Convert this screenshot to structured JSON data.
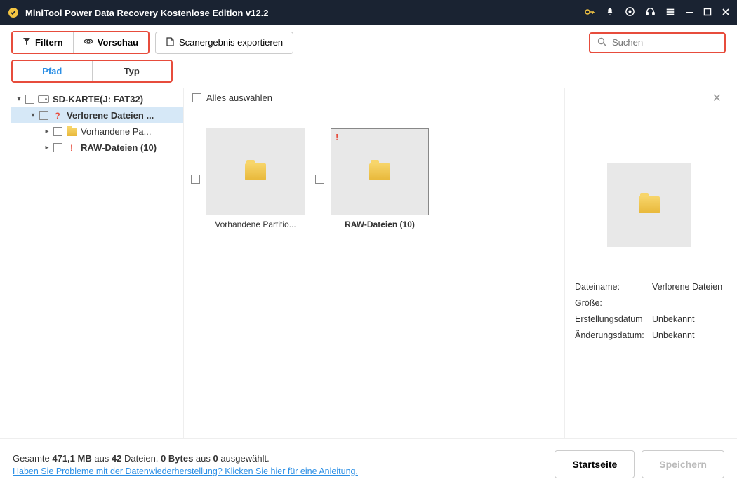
{
  "titlebar": {
    "title": "MiniTool Power Data Recovery Kostenlose Edition v12.2"
  },
  "toolbar": {
    "filter": "Filtern",
    "preview": "Vorschau",
    "export": "Scanergebnis exportieren",
    "search_placeholder": "Suchen"
  },
  "tabs": {
    "path": "Pfad",
    "type": "Typ",
    "active": "path"
  },
  "tree": {
    "root": {
      "label": "SD-KARTE(J: FAT32)"
    },
    "lost": {
      "label": "Verlorene Dateien ..."
    },
    "existing": {
      "label": "Vorhandene Pa..."
    },
    "raw": {
      "label": "RAW-Dateien (10)"
    }
  },
  "content": {
    "select_all": "Alles auswählen",
    "items": [
      {
        "label": "Vorhandene Partitio...",
        "badge": ""
      },
      {
        "label": "RAW-Dateien (10)",
        "badge": "!"
      }
    ]
  },
  "details": {
    "filename_k": "Dateiname:",
    "filename_v": "Verlorene Dateien",
    "size_k": "Größe:",
    "size_v": "",
    "created_k": "Erstellungsdatum",
    "created_v": "Unbekannt",
    "modified_k": "Änderungsdatum:",
    "modified_v": "Unbekannt"
  },
  "footer": {
    "status_prefix": "Gesamte ",
    "total_size": "471,1 MB",
    "status_mid1": " aus ",
    "total_files": "42",
    "status_mid2": " Dateien.  ",
    "sel_size": "0 Bytes",
    "status_mid3": " aus ",
    "sel_files": "0",
    "status_suffix": " ausgewählt.",
    "help_link": "Haben Sie Probleme mit der Datenwiederherstellung? Klicken Sie hier für eine Anleitung.",
    "home": "Startseite",
    "save": "Speichern"
  }
}
